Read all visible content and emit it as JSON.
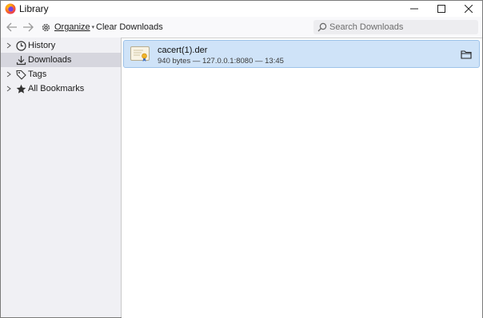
{
  "window": {
    "title": "Library",
    "controls": {
      "minimize": "minimize-icon",
      "maximize": "maximize-icon",
      "close": "close-icon"
    }
  },
  "toolbar": {
    "back_icon": "back-arrow-icon",
    "forward_icon": "forward-arrow-icon",
    "organize_label": "Organize",
    "clear_downloads_label": "Clear Downloads",
    "search_placeholder": "Search Downloads"
  },
  "sidebar": {
    "items": [
      {
        "label": "History",
        "icon": "clock-icon",
        "expandable": true,
        "selected": false
      },
      {
        "label": "Downloads",
        "icon": "download-icon",
        "expandable": false,
        "selected": true
      },
      {
        "label": "Tags",
        "icon": "tag-icon",
        "expandable": true,
        "selected": false
      },
      {
        "label": "All Bookmarks",
        "icon": "star-icon",
        "expandable": true,
        "selected": false
      }
    ]
  },
  "downloads": [
    {
      "filename": "cacert(1).der",
      "status": "940 bytes — 127.0.0.1:8080 — 13:45",
      "icon": "certificate-file-icon",
      "action_icon": "folder-icon"
    }
  ],
  "colors": {
    "selected_row_bg": "#cfe3f8",
    "selected_row_border": "#9ec3ea",
    "sidebar_bg": "#f0f0f4",
    "sidebar_selected_bg": "#d6d6de"
  }
}
